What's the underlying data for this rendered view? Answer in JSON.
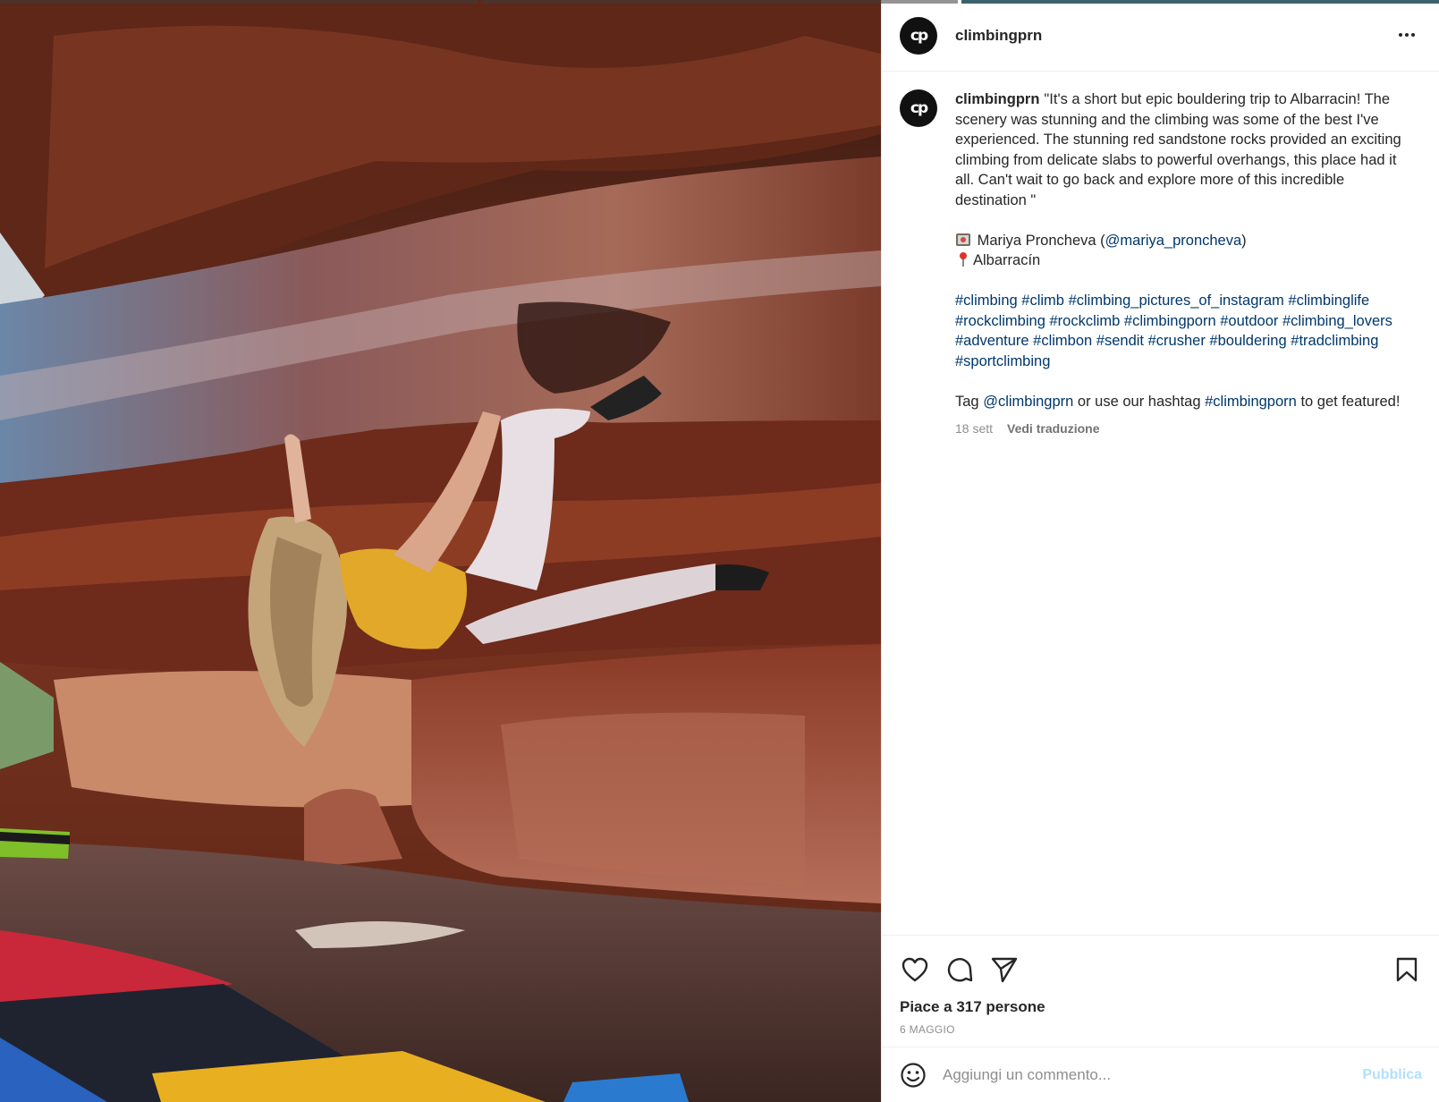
{
  "post": {
    "username": "climbingprn",
    "avatar_initials": "cp",
    "more_icon": "more-horizontal-icon"
  },
  "caption": {
    "username": "climbingprn",
    "line1": "\"It's a short but epic bouldering trip to Albarracin! The scenery was stunning and the climbing was some of the best I've experienced. The stunning red sandstone rocks provided an exciting climbing from delicate slabs to powerful overhangs, this place had it all. Can't wait to go back and explore more of this incredible destination \"",
    "credit_name": "Mariya Proncheva",
    "credit_open": "(",
    "credit_handle": "@mariya_proncheva",
    "credit_close": ")",
    "location": "Albarracín",
    "hashtags": [
      "#climbing",
      "#climb",
      "#climbing_pictures_of_instagram",
      "#climbinglife",
      "#rockclimbing",
      "#rockclimb",
      "#climbingporn",
      "#outdoor",
      "#climbing_lovers",
      "#adventure",
      "#climbon",
      "#sendit",
      "#crusher",
      "#bouldering",
      "#tradclimbing",
      "#sportclimbing"
    ],
    "cta_prefix": "Tag",
    "cta_handle": "@climbingprn",
    "cta_middle": "or use our hashtag",
    "cta_tag": "#climbingporn",
    "cta_suffix": "to get featured!",
    "time": "18 sett",
    "translate": "Vedi traduzione"
  },
  "actions": {
    "like_icon": "heart-icon",
    "comment_icon": "comment-icon",
    "share_icon": "send-icon",
    "save_icon": "bookmark-icon",
    "likes_text": "Piace a 317 persone",
    "date": "6 MAGGIO"
  },
  "comment": {
    "placeholder": "Aggiungi un commento...",
    "publish": "Pubblica",
    "emoji_icon": "smile-icon"
  },
  "colors": {
    "link": "#00376b",
    "publish_disabled": "#b2dffc",
    "muted": "#8e8e8e"
  }
}
